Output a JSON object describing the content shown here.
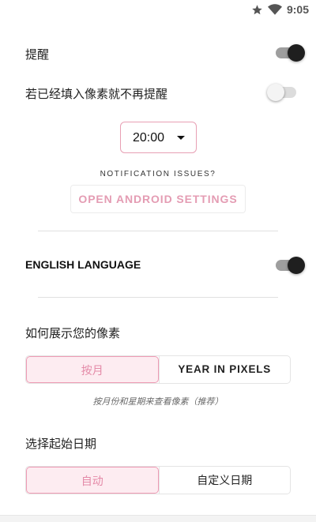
{
  "status_bar": {
    "time": "9:05",
    "icons": [
      "star-icon",
      "wifi-icon"
    ]
  },
  "reminder": {
    "label": "提醒",
    "enabled": true
  },
  "skip_if_filled": {
    "label": "若已经填入像素就不再提醒",
    "enabled": false
  },
  "time_picker": {
    "value": "20:00"
  },
  "notification": {
    "caption": "NOTIFICATION ISSUES?",
    "button_label": "OPEN ANDROID SETTINGS"
  },
  "english_language": {
    "label": "ENGLISH LANGUAGE",
    "enabled": true
  },
  "display_mode": {
    "title": "如何展示您的像素",
    "options": [
      "按月",
      "YEAR IN PIXELS"
    ],
    "selected": "按月",
    "hint": "按月份和星期来查看像素（推荐）"
  },
  "start_date": {
    "title": "选择起始日期",
    "options": [
      "自动",
      "自定义日期"
    ],
    "selected": "自动"
  },
  "colors": {
    "accent": "#e49cb3",
    "accent_bg": "#fdecf1",
    "toggle_on": "#1f1f1f"
  }
}
